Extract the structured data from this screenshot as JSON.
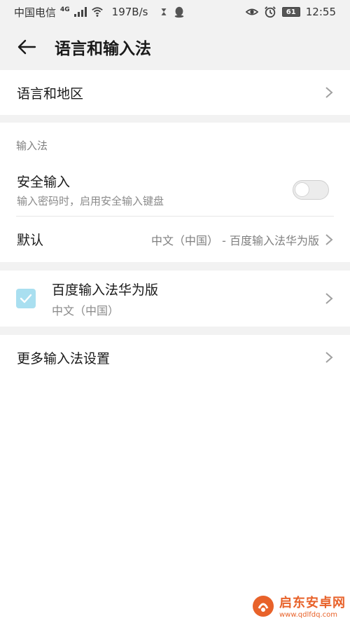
{
  "status_bar": {
    "carrier": "中国电信",
    "network": "4G",
    "speed": "197B/s",
    "battery": "61",
    "time": "12:55",
    "icons": [
      "signal-icon",
      "wifi-icon",
      "hourglass-icon",
      "qq-icon",
      "eye-icon",
      "alarm-icon",
      "battery-icon"
    ]
  },
  "header": {
    "title": "语言和输入法",
    "back_icon": "back-arrow-icon"
  },
  "language_region": {
    "label": "语言和地区"
  },
  "input_section": {
    "header": "输入法",
    "secure_input": {
      "label": "安全输入",
      "description": "输入密码时，启用安全输入键盘",
      "enabled": false
    },
    "default": {
      "label": "默认",
      "value": "中文（中国） - 百度输入法华为版"
    }
  },
  "keyboard": {
    "name": "百度输入法华为版",
    "language": "中文（中国）",
    "checked": true
  },
  "more_settings": {
    "label": "更多输入法设置"
  },
  "watermark": {
    "title": "启东安卓网",
    "url": "www.qdlfdq.com"
  },
  "colors": {
    "background": "#f2f2f2",
    "card": "#ffffff",
    "checkbox": "#a9dff0",
    "watermark": "#e8622a"
  }
}
